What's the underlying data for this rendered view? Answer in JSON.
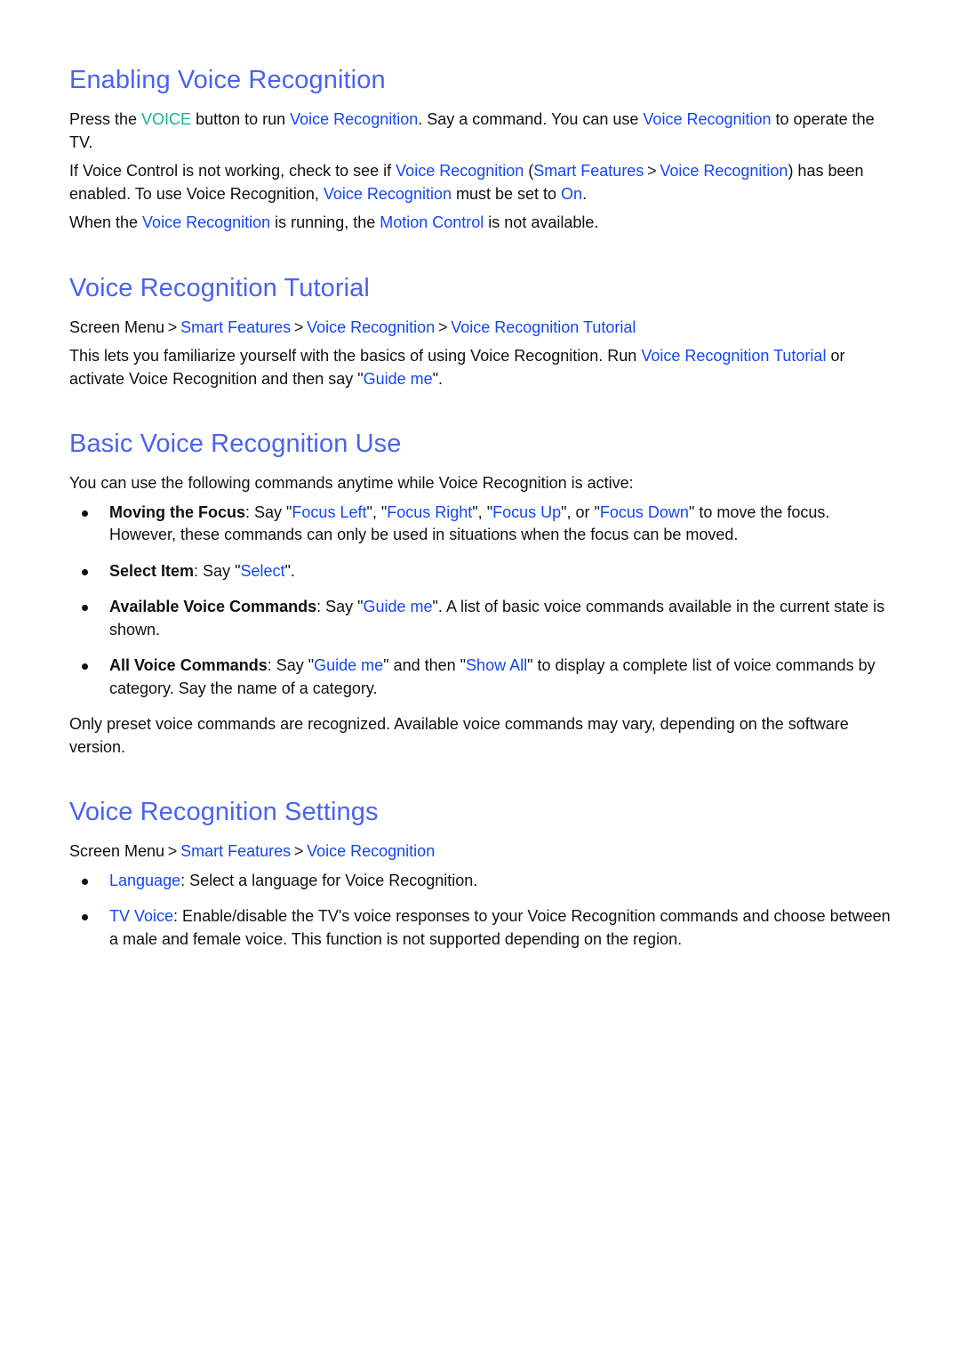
{
  "colors": {
    "heading": "#4a63f0",
    "link": "#1446f5",
    "key": "#18b48c",
    "text": "#111111"
  },
  "sections": [
    {
      "title": "Enabling Voice Recognition",
      "paragraphs": [
        {
          "parts": [
            "Press the ",
            "VOICE",
            " button to run ",
            "Voice Recognition",
            ". Say a command. You can use ",
            "Voice Recognition",
            " to operate the TV."
          ]
        },
        {
          "parts": [
            "If Voice Control is not working, check to see if ",
            "Voice Recognition",
            " (",
            "Smart Features",
            " ",
            "Voice Recognition",
            ") has been enabled. To use Voice Recognition, ",
            "Voice Recognition",
            " must be set to ",
            "On",
            "."
          ]
        },
        {
          "parts": [
            "When the ",
            "Voice Recognition",
            " is running, the ",
            "Motion Control",
            " is not available."
          ]
        }
      ]
    },
    {
      "title": "Voice Recognition Tutorial",
      "breadcrumb": {
        "root": "Screen Menu",
        "items": [
          "Smart Features",
          "Voice Recognition",
          "Voice Recognition Tutorial"
        ],
        "separator": ">"
      },
      "paragraphs": [
        {
          "parts": [
            "This lets you familiarize yourself with the basics of using Voice Recognition. Run ",
            "Voice Recognition Tutorial",
            " or activate Voice Recognition and then say \"",
            "Guide me",
            "\"."
          ]
        }
      ]
    },
    {
      "title": "Basic Voice Recognition Use",
      "intro": "You can use the following commands anytime while Voice Recognition is active:",
      "bullets": [
        {
          "label": "Moving the Focus",
          "parts": [
            ": Say \"",
            "Focus Left",
            "\", \"",
            "Focus Right",
            "\", \"",
            "Focus Up",
            "\", or \"",
            "Focus Down",
            "\" to move the focus. However, these commands can only be used in situations when the focus can be moved."
          ]
        },
        {
          "label": "Select Item",
          "parts": [
            ": Say \"",
            "Select",
            "\"."
          ]
        },
        {
          "label": "Available Voice Commands",
          "parts": [
            ": Say \"",
            "Guide me",
            "\". A list of basic voice commands available in the current state is shown."
          ]
        },
        {
          "label": "All Voice Commands",
          "parts": [
            ": Say \"",
            "Guide me",
            "\" and then \"",
            "Show All",
            "\" to display a complete list of voice commands by category. Say the name of a category."
          ]
        }
      ],
      "note": "Only preset voice commands are recognized. Available voice commands may vary, depending on the software version."
    },
    {
      "title": "Voice Recognition Settings",
      "breadcrumb": {
        "root": "Screen Menu",
        "items": [
          "Smart Features",
          "Voice Recognition"
        ],
        "separator": ">"
      },
      "bullets": [
        {
          "label": "Language",
          "text": ": Select a language for Voice Recognition."
        },
        {
          "label": "TV Voice",
          "text": ": Enable/disable the TV's voice responses to your Voice Recognition commands and choose between a male and female voice. This function is not supported depending on the region."
        }
      ]
    }
  ]
}
